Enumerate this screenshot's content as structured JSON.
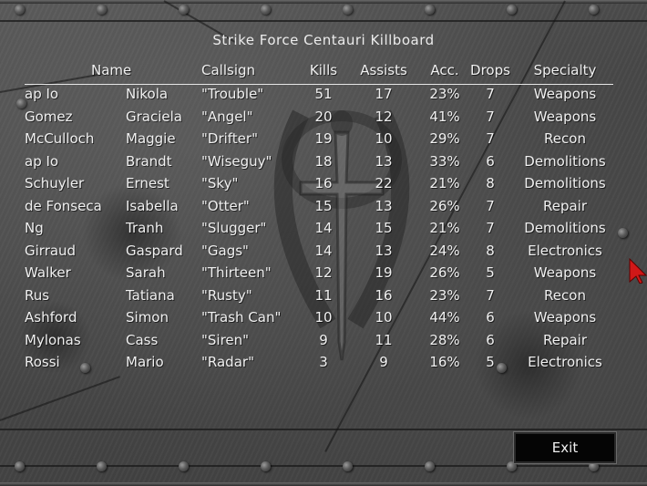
{
  "title": "Strike Force Centauri Killboard",
  "headers": {
    "name": "Name",
    "callsign": "Callsign",
    "kills": "Kills",
    "assists": "Assists",
    "accuracy": "Acc.",
    "drops": "Drops",
    "specialty": "Specialty"
  },
  "rows": [
    {
      "last": "ap Io",
      "first": "Nikola",
      "callsign": "\"Trouble\"",
      "kills": "51",
      "assists": "17",
      "acc": "23%",
      "drops": "7",
      "specialty": "Weapons"
    },
    {
      "last": "Gomez",
      "first": "Graciela",
      "callsign": "\"Angel\"",
      "kills": "20",
      "assists": "12",
      "acc": "41%",
      "drops": "7",
      "specialty": "Weapons"
    },
    {
      "last": "McCulloch",
      "first": "Maggie",
      "callsign": "\"Drifter\"",
      "kills": "19",
      "assists": "10",
      "acc": "29%",
      "drops": "7",
      "specialty": "Recon"
    },
    {
      "last": "ap Io",
      "first": "Brandt",
      "callsign": "\"Wiseguy\"",
      "kills": "18",
      "assists": "13",
      "acc": "33%",
      "drops": "6",
      "specialty": "Demolitions"
    },
    {
      "last": "Schuyler",
      "first": "Ernest",
      "callsign": "\"Sky\"",
      "kills": "16",
      "assists": "22",
      "acc": "21%",
      "drops": "8",
      "specialty": "Demolitions"
    },
    {
      "last": "de Fonseca",
      "first": "Isabella",
      "callsign": "\"Otter\"",
      "kills": "15",
      "assists": "13",
      "acc": "26%",
      "drops": "7",
      "specialty": "Repair"
    },
    {
      "last": "Ng",
      "first": "Tranh",
      "callsign": "\"Slugger\"",
      "kills": "14",
      "assists": "15",
      "acc": "21%",
      "drops": "7",
      "specialty": "Demolitions"
    },
    {
      "last": "Girraud",
      "first": "Gaspard",
      "callsign": "\"Gags\"",
      "kills": "14",
      "assists": "13",
      "acc": "24%",
      "drops": "8",
      "specialty": "Electronics"
    },
    {
      "last": "Walker",
      "first": "Sarah",
      "callsign": "\"Thirteen\"",
      "kills": "12",
      "assists": "19",
      "acc": "26%",
      "drops": "5",
      "specialty": "Weapons"
    },
    {
      "last": "Rus",
      "first": "Tatiana",
      "callsign": "\"Rusty\"",
      "kills": "11",
      "assists": "16",
      "acc": "23%",
      "drops": "7",
      "specialty": "Recon"
    },
    {
      "last": "Ashford",
      "first": "Simon",
      "callsign": "\"Trash Can\"",
      "kills": "10",
      "assists": "10",
      "acc": "44%",
      "drops": "6",
      "specialty": "Weapons"
    },
    {
      "last": "Mylonas",
      "first": "Cass",
      "callsign": "\"Siren\"",
      "kills": "9",
      "assists": "11",
      "acc": "28%",
      "drops": "6",
      "specialty": "Repair"
    },
    {
      "last": "Rossi",
      "first": "Mario",
      "callsign": "\"Radar\"",
      "kills": "3",
      "assists": "9",
      "acc": "16%",
      "drops": "5",
      "specialty": "Electronics"
    }
  ],
  "exit_label": "Exit",
  "colors": {
    "text": "#f0f0f0",
    "background": "#4a4a4a",
    "exit_button": "#050505",
    "cursor": "#d01818"
  },
  "icons": {
    "emblem": "sword-shield-emblem-icon",
    "cursor": "arrow-cursor-icon"
  }
}
